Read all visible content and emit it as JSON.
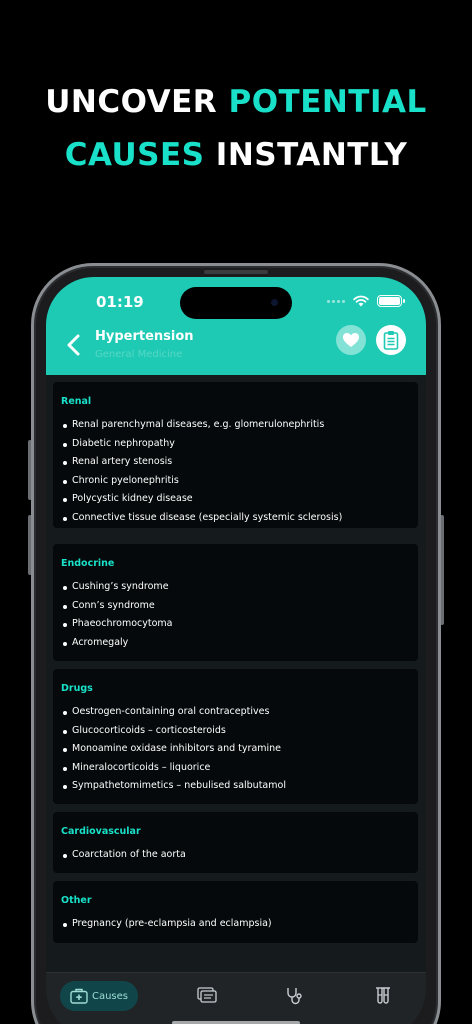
{
  "promo": {
    "line1_white": "UNCOVER ",
    "line1_accent": "POTENTIAL",
    "line2_accent": "CAUSES",
    "line2_white": " INSTANTLY",
    "accent_color": "#19e0c8"
  },
  "status_bar": {
    "time": "01:19"
  },
  "header": {
    "title": "Hypertension",
    "subtitle": "General Medicine",
    "back_icon": "chevron-left-icon",
    "favorite_icon": "heart-icon",
    "notes_icon": "clipboard-icon",
    "color": "#1ecab4"
  },
  "sections": [
    {
      "title": "Renal",
      "items": [
        "Renal parenchymal diseases, e.g. glomerulonephritis",
        "Diabetic nephropathy",
        "Renal artery stenosis",
        "Chronic pyelonephritis",
        "Polycystic kidney disease",
        "Connective tissue disease (especially systemic sclerosis)"
      ]
    },
    {
      "title": "Endocrine",
      "items": [
        "Cushing’s syndrome",
        "Conn’s syndrome",
        "Phaeochromocytoma",
        "Acromegaly"
      ]
    },
    {
      "title": "Drugs",
      "items": [
        "Oestrogen-containing oral contraceptives",
        "Glucocorticoids – corticosteroids",
        "Monoamine oxidase inhibitors and tyramine",
        "Mineralocorticoids – liquorice",
        "Sympathetomimetics – nebulised salbutamol"
      ]
    },
    {
      "title": "Cardiovascular",
      "items": [
        "Coarctation of the aorta"
      ]
    },
    {
      "title": "Other",
      "items": [
        "Pregnancy (pre-eclampsia and eclampsia)"
      ]
    }
  ],
  "tabbar": {
    "tabs": [
      {
        "label": "Causes",
        "icon": "first-aid-kit-icon",
        "active": true
      },
      {
        "label": "",
        "icon": "chat-cards-icon",
        "active": false
      },
      {
        "label": "",
        "icon": "stethoscope-icon",
        "active": false
      },
      {
        "label": "",
        "icon": "test-tubes-icon",
        "active": false
      }
    ]
  }
}
